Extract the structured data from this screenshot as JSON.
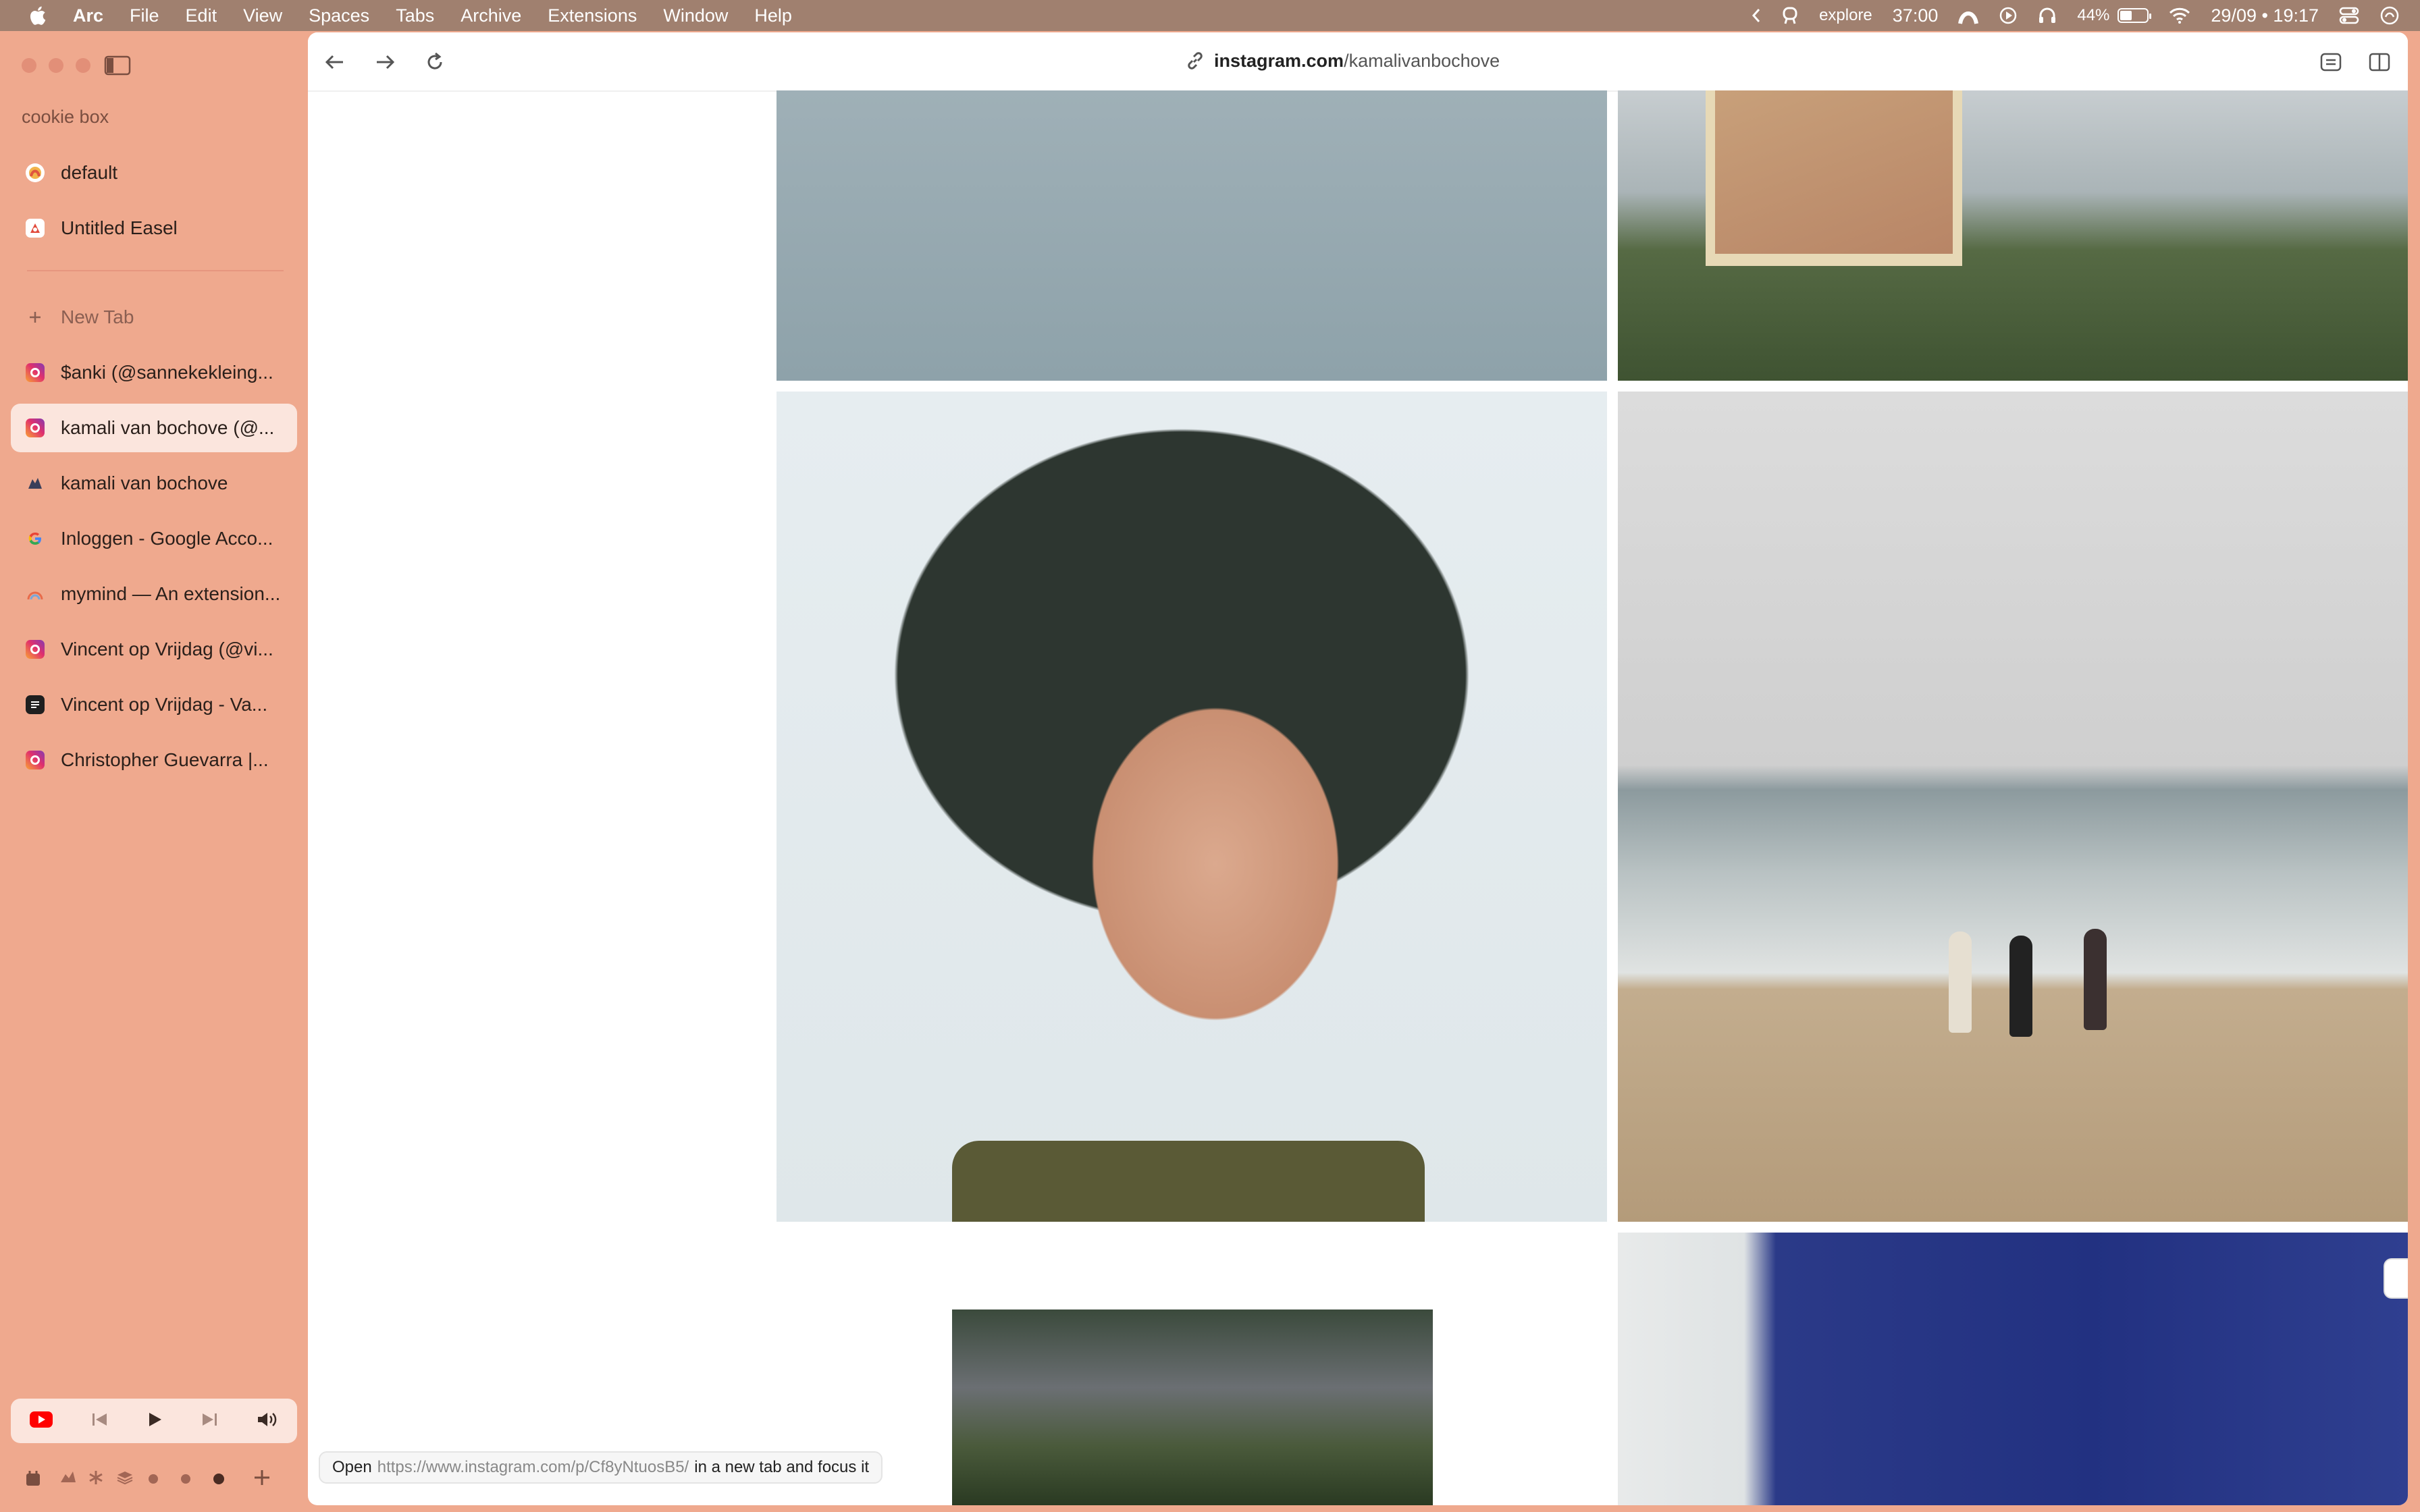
{
  "menubar": {
    "app": "Arc",
    "items": [
      "File",
      "Edit",
      "View",
      "Spaces",
      "Tabs",
      "Archive",
      "Extensions",
      "Window",
      "Help"
    ],
    "status_explore": "explore",
    "timer": "37:00",
    "battery": "44%",
    "battery_level": 0.44,
    "datetime": "29/09 • 19:17"
  },
  "sidebar": {
    "space_name": "cookie box",
    "pinned": [
      {
        "label": "default",
        "icon": "arc-icon"
      },
      {
        "label": "Untitled Easel",
        "icon": "easel-icon"
      }
    ],
    "new_tab_label": "New Tab",
    "tabs": [
      {
        "label": "$anki (@sannekekleing...",
        "icon": "instagram-icon",
        "active": false
      },
      {
        "label": "kamali van bochove (@...",
        "icon": "instagram-icon",
        "active": true
      },
      {
        "label": "kamali van bochove",
        "icon": "site-icon",
        "active": false
      },
      {
        "label": "Inloggen - Google Acco...",
        "icon": "google-icon",
        "active": false
      },
      {
        "label": "mymind — An extension...",
        "icon": "mymind-icon",
        "active": false
      },
      {
        "label": "Vincent op Vrijdag (@vi...",
        "icon": "instagram-icon",
        "active": false
      },
      {
        "label": "Vincent op Vrijdag - Va...",
        "icon": "site-icon",
        "active": false
      },
      {
        "label": "Christopher Guevarra |...",
        "icon": "instagram-icon",
        "active": false
      }
    ]
  },
  "browser": {
    "url_domain": "instagram.com",
    "url_path": "/kamalivanbochove"
  },
  "status_bar": {
    "prefix": "Open",
    "link": "https://www.instagram.com/p/Cf8yNtuosB5/",
    "suffix": "in a new tab and focus it"
  },
  "colors": {
    "sidebar_bg": "#efa98e",
    "menubar_bg": "#a0806f",
    "active_tab_bg": "#fbe5dd"
  }
}
